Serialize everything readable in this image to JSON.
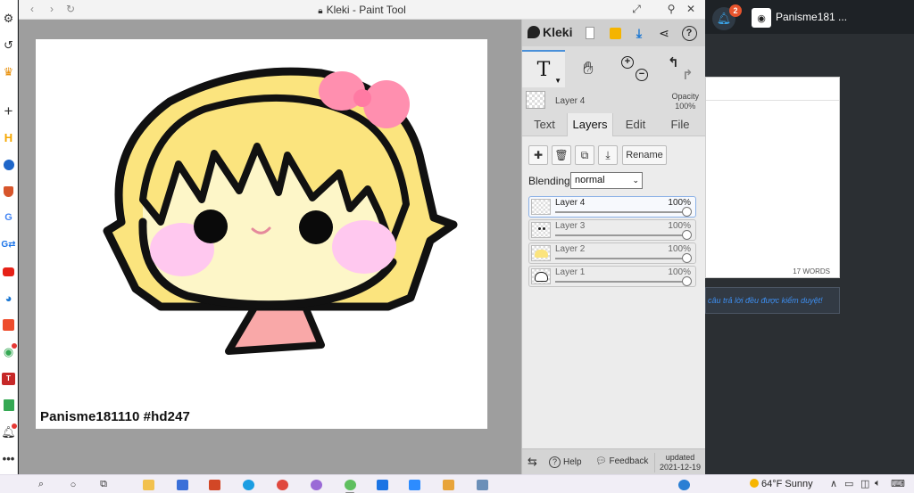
{
  "window": {
    "title": "Kleki - Paint Tool"
  },
  "canvas": {
    "signature": "Panisme181110 #hd247"
  },
  "panel": {
    "logo": "Kleki",
    "opacity_label": "Opacity",
    "opacity_value": "100%",
    "current_layer": "Layer 4",
    "tabs": [
      {
        "label": "Text"
      },
      {
        "label": "Layers"
      },
      {
        "label": "Edit"
      },
      {
        "label": "File"
      }
    ],
    "rename_label": "Rename",
    "blending_label": "Blending",
    "blending_value": "normal",
    "layers": [
      {
        "name": "Layer 4",
        "opacity": "100%"
      },
      {
        "name": "Layer 3",
        "opacity": "100%"
      },
      {
        "name": "Layer 2",
        "opacity": "100%"
      },
      {
        "name": "Layer 1",
        "opacity": "100%"
      }
    ],
    "footer": {
      "help": "Help",
      "feedback": "Feedback",
      "updated_label": "updated",
      "updated_date": "2021-12-19"
    }
  },
  "background_app": {
    "notification_count": "2",
    "username": "Panisme181 ...",
    "word_count": "17 WORDS",
    "notice": "câu trả lời đều được kiểm duyệt!"
  },
  "taskbar": {
    "weather": "64°F  Sunny"
  }
}
